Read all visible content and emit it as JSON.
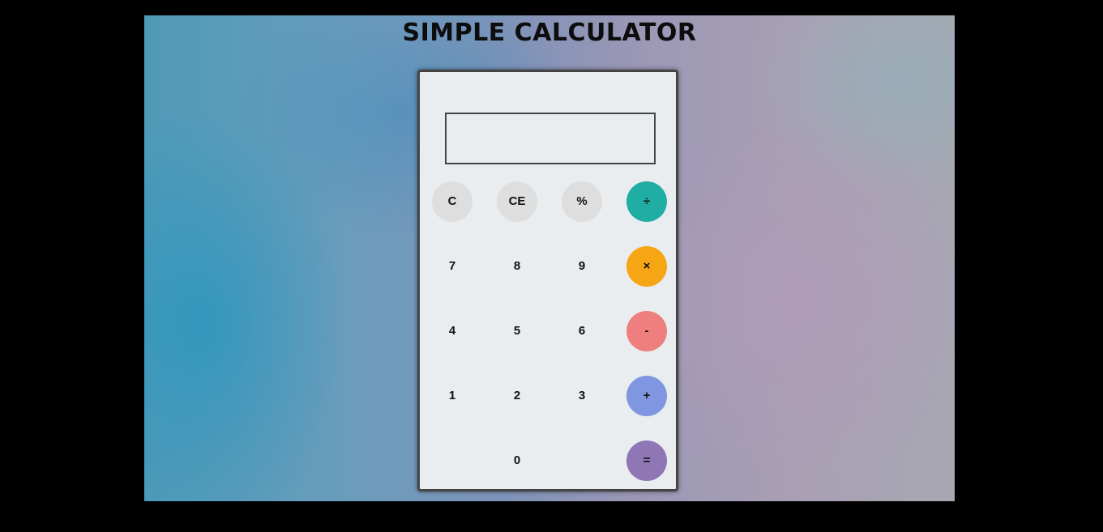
{
  "page": {
    "title": "SIMPLE CALCULATOR"
  },
  "display": {
    "value": ""
  },
  "keys": {
    "clear": "C",
    "clear_entry": "CE",
    "percent": "%",
    "divide": "÷",
    "seven": "7",
    "eight": "8",
    "nine": "9",
    "multiply": "×",
    "four": "4",
    "five": "5",
    "six": "6",
    "subtract": "-",
    "one": "1",
    "two": "2",
    "three": "3",
    "add": "+",
    "zero": "0",
    "equals": "="
  },
  "colors": {
    "divide": "#20ada3",
    "multiply": "#f6a514",
    "subtract": "#ef7f7f",
    "add": "#8196e0",
    "equals": "#8f76b5",
    "function_keys": "#dedede"
  }
}
